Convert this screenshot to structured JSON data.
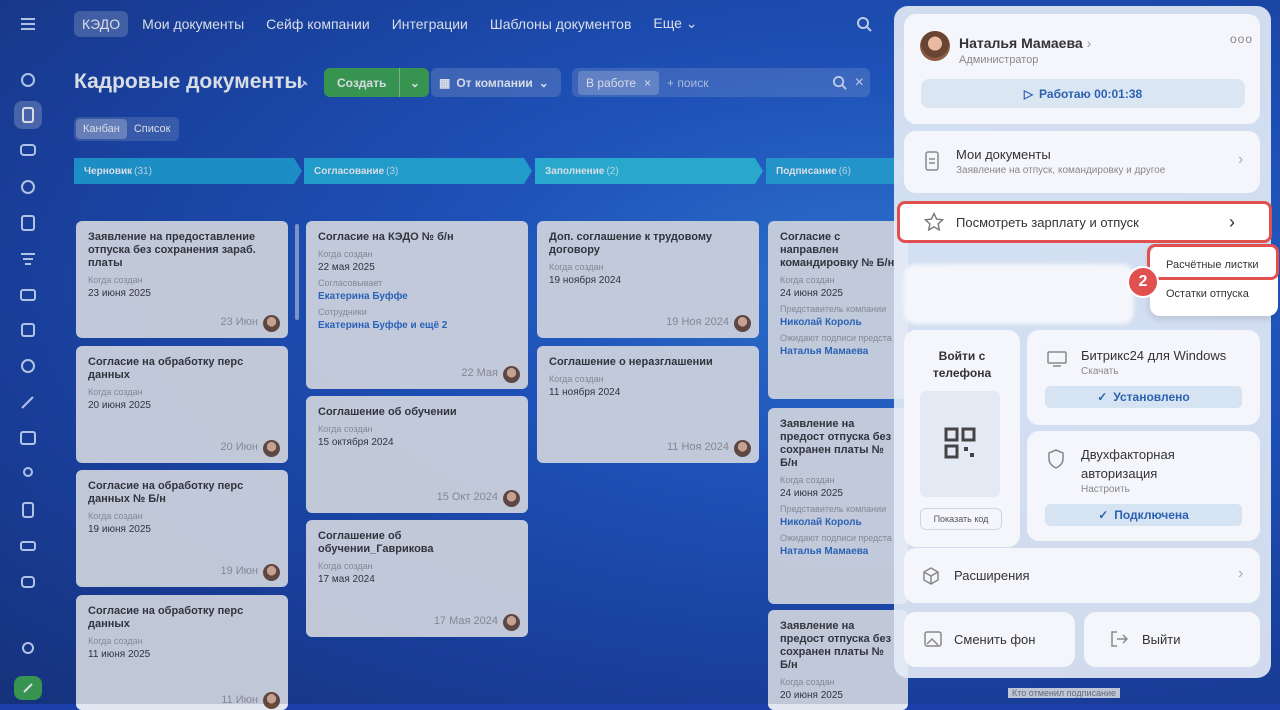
{
  "nav": {
    "tabs": [
      "КЭДО",
      "Мои документы",
      "Сейф компании",
      "Интеграции",
      "Шаблоны документов",
      "Еще"
    ]
  },
  "header": {
    "title": "Кадровые документы",
    "create": "Создать",
    "company_filter": "От компании",
    "filter_chip": "В работе",
    "search_placeholder": "+ поиск"
  },
  "views": [
    "Канбан",
    "Список"
  ],
  "columns": [
    {
      "name": "Черновик",
      "count": "(31)",
      "color": "#1c9fd8"
    },
    {
      "name": "Согласование",
      "count": "(3)",
      "color": "#1fb0df"
    },
    {
      "name": "Заполнение",
      "count": "(2)",
      "color": "#2ac0e3"
    },
    {
      "name": "Подписание",
      "count": "(6)",
      "color": "#23a8dd"
    }
  ],
  "cards": {
    "c1": {
      "title": "Заявление на предоставление отпуска без сохранения зараб. платы",
      "k1": "Когда создан",
      "v1": "23 июня 2025",
      "date": "23 Июн"
    },
    "c2": {
      "title": "Согласие на обработку перс данных",
      "k1": "Когда создан",
      "v1": "20 июня 2025",
      "date": "20 Июн"
    },
    "c3": {
      "title": "Согласие на обработку перс данных № Б/н",
      "k1": "Когда создан",
      "v1": "19 июня 2025",
      "date": "19 Июн"
    },
    "c4": {
      "title": "Согласие на обработку перс данных",
      "k1": "Когда создан",
      "v1": "11 июня 2025",
      "date": "11 Июн"
    },
    "c5": {
      "title": "Согласие на КЭДО № б/н",
      "k1": "Когда создан",
      "v1": "22 мая 2025",
      "k2": "Согласовывает",
      "v2": "Екатерина Буффе",
      "k3": "Сотрудники",
      "v3": "Екатерина Буффе и ещё 2",
      "date": "22 Мая"
    },
    "c6": {
      "title": "Соглашение об обучении",
      "k1": "Когда создан",
      "v1": "15 октября 2024",
      "date": "15 Окт 2024"
    },
    "c7": {
      "title": "Соглашение об обучении_Гаврикова",
      "k1": "Когда создан",
      "v1": "17 мая 2024",
      "date": "17 Мая 2024"
    },
    "c8": {
      "title": "Доп. соглашение к трудовому договору",
      "k1": "Когда создан",
      "v1": "19 ноября 2024",
      "date": "19 Ноя 2024"
    },
    "c9": {
      "title": "Соглашение о неразглашении",
      "k1": "Когда создан",
      "v1": "11 ноября 2024",
      "date": "11 Ноя 2024"
    },
    "c10": {
      "title": "Согласие с направлен командировку № Б/н",
      "k1": "Когда создан",
      "v1": "24 июня 2025",
      "k2": "Представитель компании",
      "v2": "Николай Король",
      "k3": "Ожидают подписи предста",
      "v3": "Наталья Мамаева"
    },
    "c11": {
      "title": "Заявление на предост отпуска без сохранен платы № Б/н",
      "k1": "Когда создан",
      "v1": "24 июня 2025",
      "k2": "Представитель компании",
      "v2": "Николай Король",
      "k3": "Ожидают подписи предста",
      "v3": "Наталья Мамаева"
    },
    "c12": {
      "title": "Заявление на предост отпуска без сохранен платы № Б/н",
      "k1": "Когда создан",
      "v1": "20 июня 2025"
    }
  },
  "bottom_note": "Кто отменил подписание",
  "panel": {
    "user_name": "Наталья Мамаева",
    "user_role": "Администратор",
    "work_status": "Работаю 00:01:38",
    "my_docs_title": "Мои документы",
    "my_docs_sub": "Заявление на отпуск, командировку и другое",
    "salary": "Посмотреть зарплату и отпуск",
    "submenu": [
      "Расчётные листки",
      "Остатки отпуска"
    ],
    "step": "2",
    "phone_login": "Войти с телефона",
    "show_code": "Показать код",
    "win_title": "Битрикс24 для Windows",
    "win_sub": "Скачать",
    "win_status": "Установлено",
    "twofa_title": "Двухфакторная авторизация",
    "twofa_sub": "Настроить",
    "twofa_status": "Подключена",
    "extensions": "Расширения",
    "change_bg": "Сменить фон",
    "logout": "Выйти"
  },
  "colors": {
    "accent_red": "#e0504f",
    "create_green": "#3aa84a",
    "link_blue": "#2c6bc7"
  }
}
